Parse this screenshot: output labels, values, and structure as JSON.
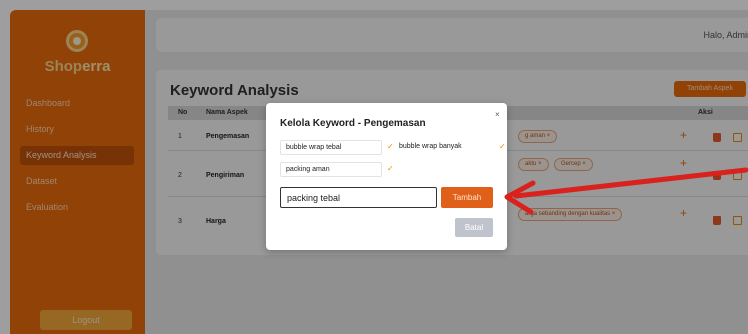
{
  "sidebar": {
    "brand_prefix": "Shop",
    "brand_suffix": "erra",
    "items": [
      {
        "label": "Dashboard"
      },
      {
        "label": "History"
      },
      {
        "label": "Keyword Analysis"
      },
      {
        "label": "Dataset"
      },
      {
        "label": "Evaluation"
      }
    ],
    "logout_label": "Logout"
  },
  "topbar": {
    "greeting": "Halo, Admin"
  },
  "page": {
    "title": "Keyword Analysis",
    "add_aspect_label": "Tambah Aspek",
    "columns": {
      "no": "No",
      "name": "Nama Aspek",
      "action": "Aksi"
    },
    "rows": [
      {
        "no": "1",
        "name": "Pengemasan",
        "chips": [
          "g aman ×"
        ]
      },
      {
        "no": "2",
        "name": "Pengiriman",
        "chips": [
          "aktu ×",
          "Gercep ×"
        ]
      },
      {
        "no": "3",
        "name": "Harga",
        "chips": [
          "arga sebanding dengan kualitas ×"
        ]
      }
    ],
    "plus_glyph": "+"
  },
  "modal": {
    "title": "Kelola Keyword - Pengemasan",
    "close_glyph": "×",
    "keywords": [
      "bubble wrap tebal",
      "bubble wrap banyak",
      "packing aman"
    ],
    "check_glyph": "✓",
    "input_value": "packing tebal",
    "add_label": "Tambah",
    "cancel_label": "Batal"
  },
  "colors": {
    "accent": "#ea6b0c",
    "annotation_arrow": "#d9221d"
  }
}
